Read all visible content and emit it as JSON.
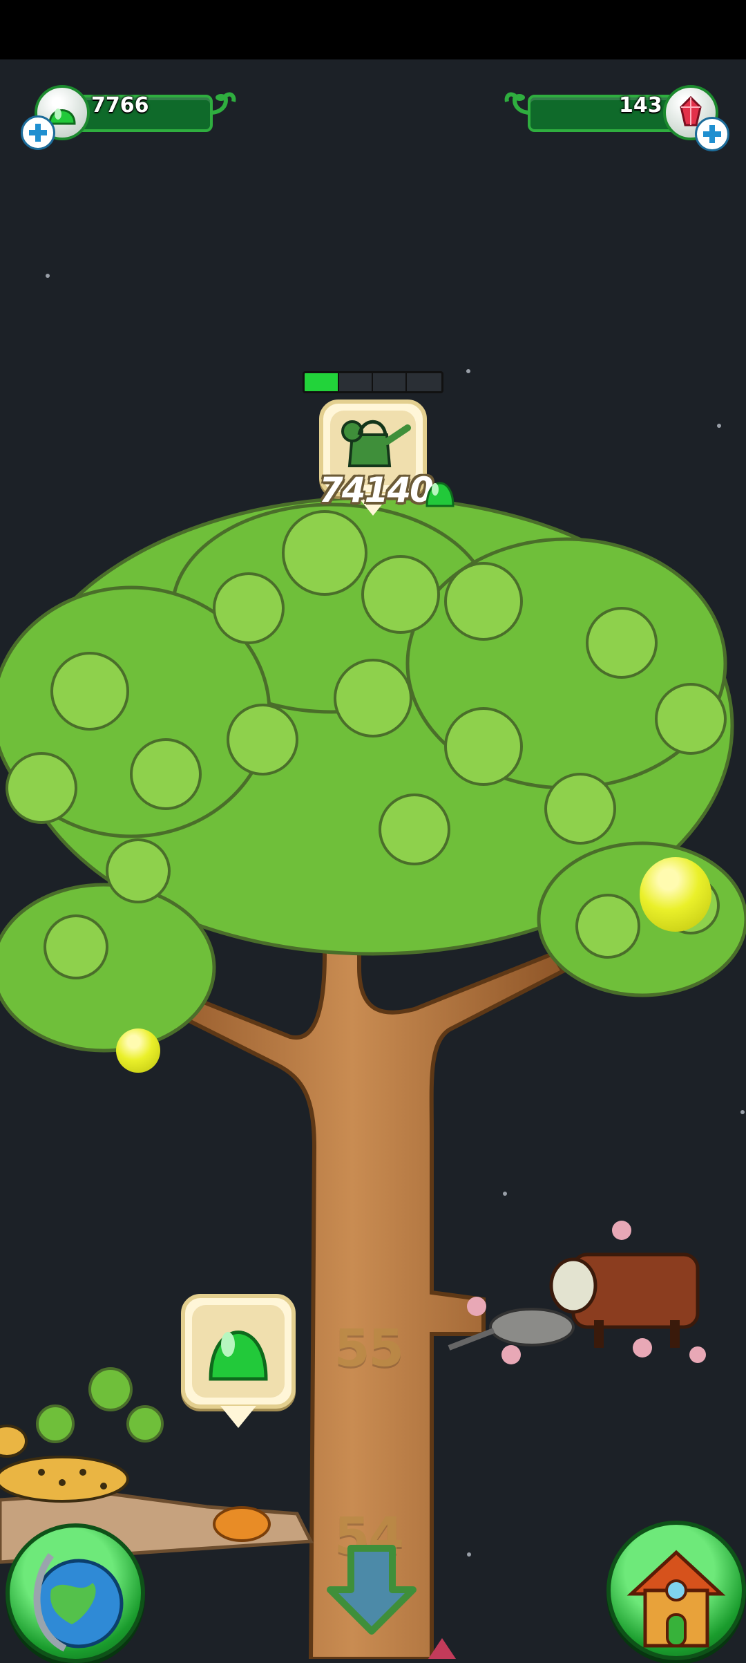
{
  "status_bar": {},
  "resources": {
    "gel": {
      "value": "7766",
      "icon": "green-gel-icon",
      "color": "#22c93a"
    },
    "gems": {
      "value": "143",
      "icon": "red-crystal-icon",
      "color": "#e2314a"
    }
  },
  "upgrade": {
    "progress_fraction": 0.25,
    "progress_segments": 4,
    "icon": "watering-can-icon",
    "cost": "74140",
    "cost_icon": "green-gel-icon"
  },
  "tree": {
    "levels": [
      {
        "label": "55"
      },
      {
        "label": "54"
      }
    ],
    "gel_reward_icon": "green-gel-icon"
  },
  "bottom_nav": {
    "left": "globe-icon",
    "center": "down-arrow-icon",
    "right": "house-icon"
  },
  "colors": {
    "background": "#1c2127",
    "leaf": "#6fbf3a",
    "trunk": "#b67842",
    "accent_green": "#22d33a"
  }
}
